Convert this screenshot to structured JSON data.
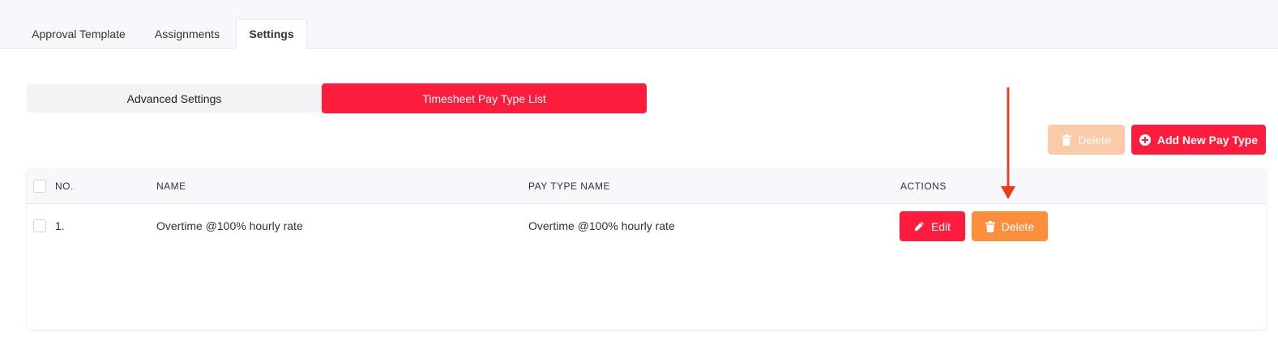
{
  "tabs": [
    {
      "label": "Approval Template"
    },
    {
      "label": "Assignments"
    },
    {
      "label": "Settings"
    }
  ],
  "segmented": {
    "advanced": "Advanced Settings",
    "paytype": "Timesheet Pay Type List"
  },
  "toolbar": {
    "delete_label": "Delete",
    "add_label": "Add New Pay Type"
  },
  "table": {
    "headers": {
      "no": "NO.",
      "name": "NAME",
      "pay_type_name": "PAY TYPE NAME",
      "actions": "ACTIONS"
    },
    "rows": [
      {
        "no": "1.",
        "name": "Overtime @100% hourly rate",
        "pay_type_name": "Overtime @100% hourly rate",
        "edit_label": "Edit",
        "delete_label": "Delete"
      }
    ]
  },
  "colors": {
    "primary": "#fc1c3c",
    "delete_active": "#fd8f3c",
    "delete_disabled": "#fbcaa9",
    "annotation_arrow": "#f0361b"
  },
  "icons": {
    "trash": "trash-icon",
    "plus_circle": "plus-circle-icon",
    "pencil": "pencil-icon",
    "arrow": "arrow-down-icon"
  }
}
